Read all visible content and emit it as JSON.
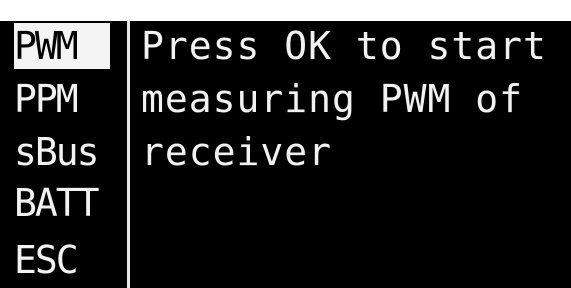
{
  "menu": {
    "items": [
      {
        "label": "PWM",
        "selected": true
      },
      {
        "label": "PPM",
        "selected": false
      },
      {
        "label": "sBus",
        "selected": false
      },
      {
        "label": "BATT",
        "selected": false
      },
      {
        "label": "ESC",
        "selected": false
      }
    ]
  },
  "message": {
    "lines": [
      "Press OK to start",
      "measuring PWM of",
      "receiver"
    ]
  },
  "colors": {
    "screen_background": "#000000",
    "text": "#f2f2f2",
    "selection_background": "#f4f4f4",
    "selection_text": "#000000"
  }
}
